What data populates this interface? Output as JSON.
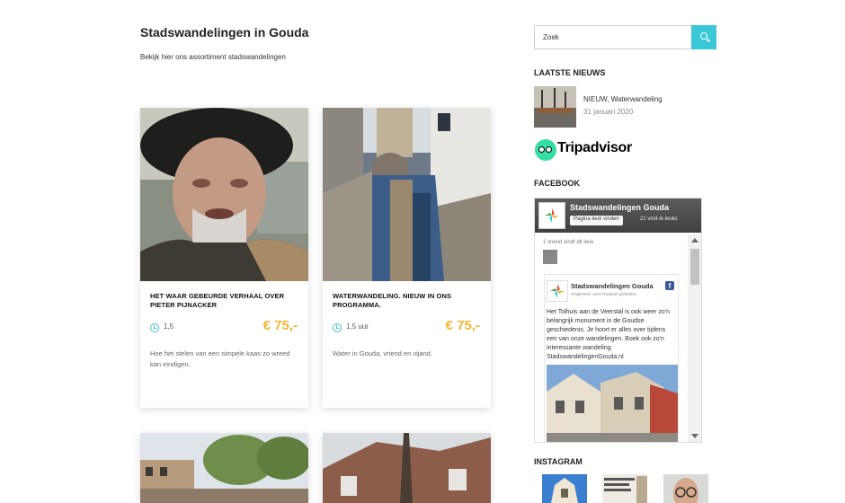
{
  "page": {
    "title": "Stadswandelingen in Gouda",
    "subtitle": "Bekijk hier ons assortiment stadswandelingen"
  },
  "cards": [
    {
      "title": "HET WAAR GEBEURDE VERHAAL OVER PIETER PIJNACKER",
      "duration": "1,5",
      "price": "€ 75,-",
      "description": "Hoe het stelen van een simpele kaas zo wreed kan eindigen."
    },
    {
      "title": "WATERWANDELING. NIEUW IN ONS PROGRAMMA.",
      "duration": "1,5 uur",
      "price": "€ 75,-",
      "description": "Water in Gouda, vriend en vijand."
    }
  ],
  "sidebar": {
    "search_placeholder": "Zoek",
    "news_heading": "LAATSTE NIEUWS",
    "news_item": {
      "title": "NIEUW, Waterwandeling",
      "date": "31 januari 2020"
    },
    "tripadvisor": "Tripadvisor",
    "facebook_heading": "FACEBOOK",
    "instagram_heading": "INSTAGRAM"
  },
  "facebook": {
    "page_name": "Stadswandelingen Gouda",
    "like_button": "Pagina leuk vinden",
    "likes": "21 vind-ik-leuks",
    "friend_text": "1 vriend vindt dit leuk",
    "post_name": "Stadswandelingen Gouda",
    "post_sub": "ongeveer een maand geleden",
    "post_text": "Het Tolhuis aan de Veerstal is ook weer zo'n belangrijk monument in de Goudse geschiedenis. Je hoort er alles over tijdens een van onze wandelingen. Boek ook zo'n interessante wandeling. StadswandelingenGouda.nl"
  },
  "colors": {
    "accent": "#3bc8d6",
    "price": "#f3b633",
    "tripadvisor": "#34e0a1",
    "facebook": "#3b5998"
  }
}
